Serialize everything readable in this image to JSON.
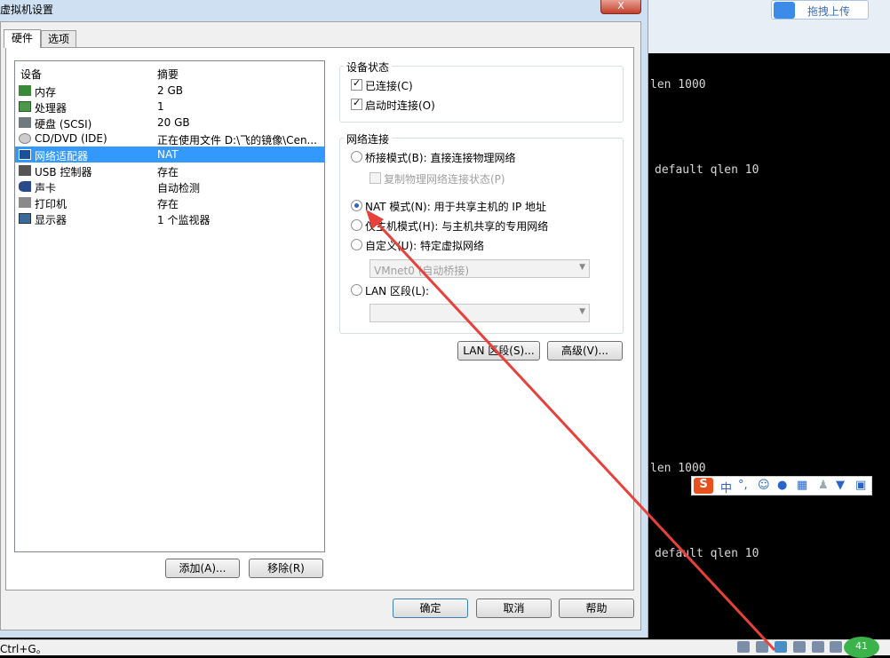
{
  "dialog": {
    "title": "虚拟机设置",
    "close": "X",
    "tabs": [
      {
        "label": "硬件"
      },
      {
        "label": "选项"
      }
    ],
    "columns": {
      "device": "设备",
      "summary": "摘要"
    },
    "devices": [
      {
        "name": "内存",
        "summary": "2 GB",
        "icon": "memory-icon"
      },
      {
        "name": "处理器",
        "summary": "1",
        "icon": "cpu-icon"
      },
      {
        "name": "硬盘 (SCSI)",
        "summary": "20 GB",
        "icon": "hard-disk-icon"
      },
      {
        "name": "CD/DVD (IDE)",
        "summary": "正在使用文件 D:\\飞的镜像\\Cen...",
        "icon": "cd-dvd-icon"
      },
      {
        "name": "网络适配器",
        "summary": "NAT",
        "icon": "network-adapter-icon"
      },
      {
        "name": "USB 控制器",
        "summary": "存在",
        "icon": "usb-icon"
      },
      {
        "name": "声卡",
        "summary": "自动检测",
        "icon": "sound-card-icon"
      },
      {
        "name": "打印机",
        "summary": "存在",
        "icon": "printer-icon"
      },
      {
        "name": "显示器",
        "summary": "1 个监视器",
        "icon": "monitor-icon"
      }
    ],
    "add_button": "添加(A)...",
    "remove_button": "移除(R)",
    "device_status": {
      "title": "设备状态",
      "connected": "已连接(C)",
      "connect_on_power": "启动时连接(O)"
    },
    "network": {
      "title": "网络连接",
      "bridged": "桥接模式(B): 直接连接物理网络",
      "replicate": "复制物理网络连接状态(P)",
      "nat": "NAT 模式(N): 用于共享主机的 IP 地址",
      "host_only": "仅主机模式(H): 与主机共享的专用网络",
      "custom": "自定义(U): 特定虚拟网络",
      "custom_value": "VMnet0 (自动桥接)",
      "lan": "LAN 区段(L):",
      "lan_value": ""
    },
    "lan_segments_button": "LAN 区段(S)...",
    "advanced_button": "高级(V)...",
    "ok_button": "确定",
    "cancel_button": "取消",
    "help_button": "帮助"
  },
  "background": {
    "upload_label": "拖拽上传",
    "terminal_lines": [
      "len 1000",
      "default qlen 10",
      "len 1000",
      "default qlen 10"
    ],
    "ime": {
      "lang": "中",
      "punct": "°,"
    },
    "status_text": "Ctrl+G。",
    "tray_badge": "41"
  },
  "colors": {
    "selection": "#3399ff",
    "annotation_arrow": "#e8403a"
  }
}
